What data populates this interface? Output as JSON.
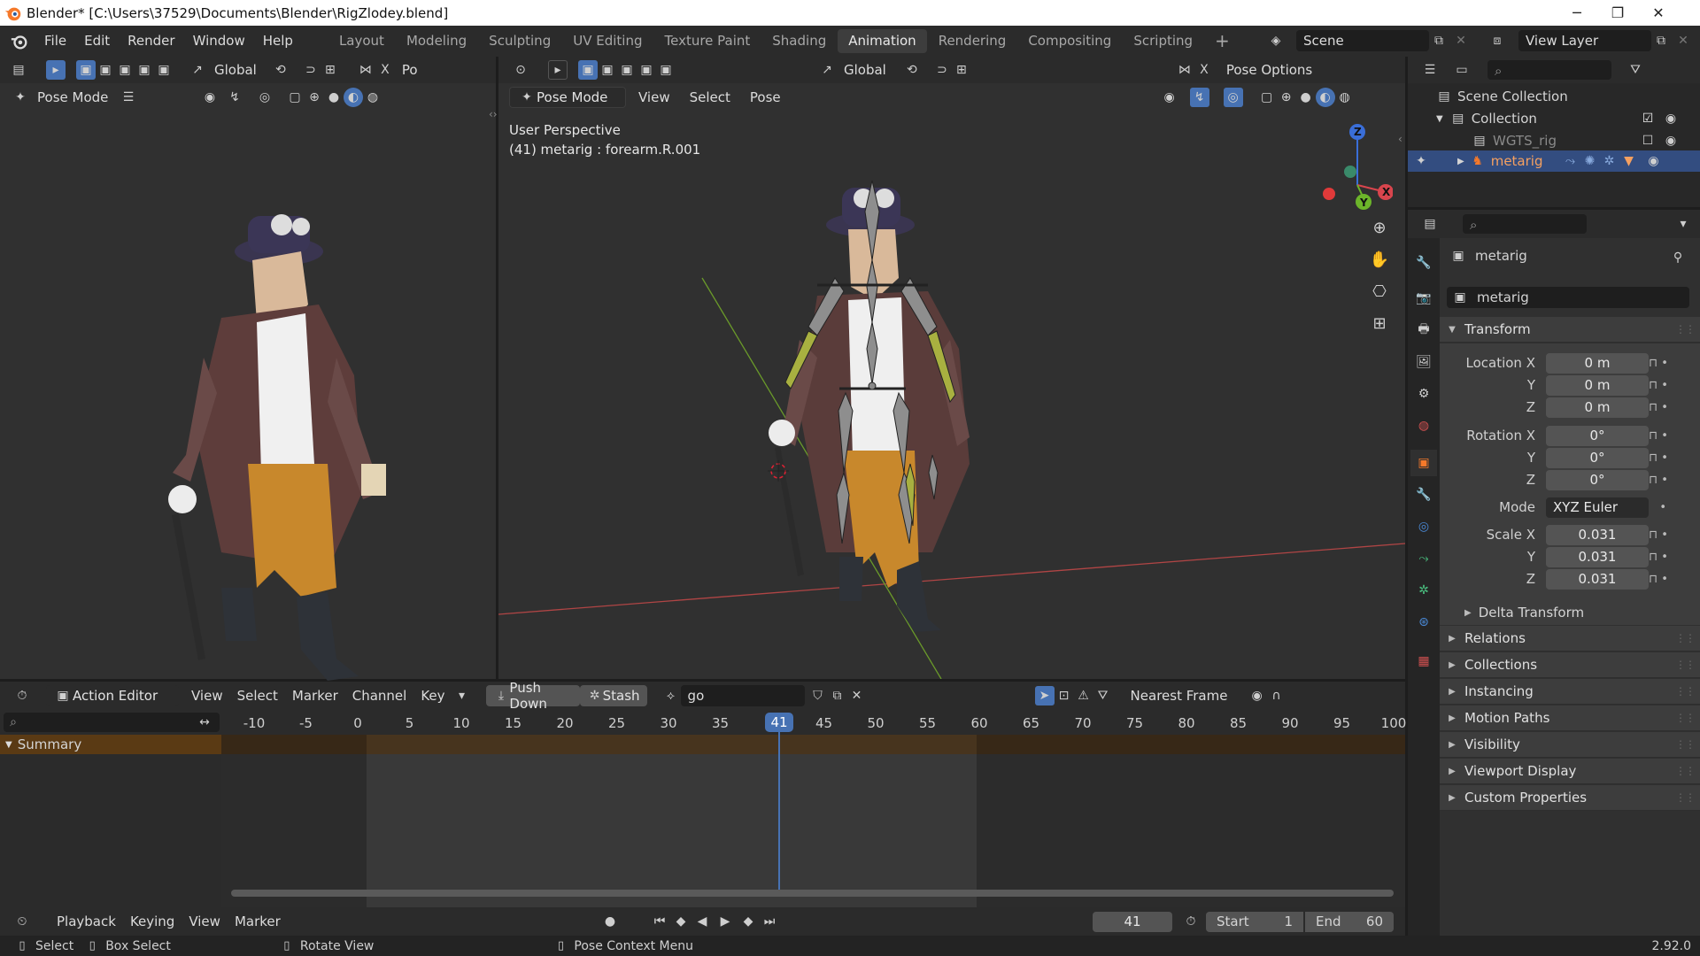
{
  "window": {
    "title": "Blender* [C:\\Users\\37529\\Documents\\Blender\\RigZlodey.blend]",
    "minimize": "─",
    "maximize": "❐",
    "close": "✕"
  },
  "menu": [
    "File",
    "Edit",
    "Render",
    "Window",
    "Help"
  ],
  "workspaces": [
    "Layout",
    "Modeling",
    "Sculpting",
    "UV Editing",
    "Texture Paint",
    "Shading",
    "Animation",
    "Rendering",
    "Compositing",
    "Scripting"
  ],
  "active_workspace": "Animation",
  "add_workspace": "+",
  "scene": {
    "name": "Scene"
  },
  "view_layer": {
    "name": "View Layer"
  },
  "left_viewport": {
    "orientation": "Global",
    "mode": "Pose Mode",
    "po_label": "Po"
  },
  "main_viewport": {
    "orientation": "Global",
    "mode": "Pose Mode",
    "menus": [
      "View",
      "Select",
      "Pose"
    ],
    "pose_options": "Pose Options",
    "perspective": "User Perspective",
    "active_bone": "(41) metarig : forearm.R.001",
    "gizmo": {
      "x": "X",
      "y": "Y",
      "z": "Z"
    }
  },
  "outliner": {
    "items": [
      {
        "label": "Scene Collection"
      },
      {
        "label": "Collection"
      },
      {
        "label": "WGTS_rig"
      },
      {
        "label": "metarig"
      }
    ]
  },
  "properties": {
    "object_name": "metarig",
    "datablock": "metarig",
    "transform_title": "Transform",
    "location": {
      "label": "Location X",
      "x": "0 m",
      "y": "0 m",
      "z": "0 m"
    },
    "rotation": {
      "label": "Rotation X",
      "x": "0°",
      "y": "0°",
      "z": "0°"
    },
    "axis_y": "Y",
    "axis_z": "Z",
    "mode_label": "Mode",
    "mode_value": "XYZ Euler",
    "scale": {
      "label": "Scale X",
      "x": "0.031",
      "y": "0.031",
      "z": "0.031"
    },
    "delta": "Delta Transform",
    "panels": [
      "Relations",
      "Collections",
      "Instancing",
      "Motion Paths",
      "Visibility",
      "Viewport Display",
      "Custom Properties"
    ]
  },
  "action_editor": {
    "mode": "Action Editor",
    "menus": [
      "View",
      "Select",
      "Marker",
      "Channel",
      "Key"
    ],
    "push_down": "Push Down",
    "stash": "Stash",
    "action_name": "go",
    "snap": "Nearest Frame",
    "summary": "Summary",
    "current_frame": "41",
    "ticks": [
      "-10",
      "-5",
      "0",
      "5",
      "10",
      "15",
      "20",
      "25",
      "30",
      "35",
      "45",
      "50",
      "55",
      "60",
      "65",
      "70",
      "75",
      "80",
      "85",
      "90",
      "95",
      "100"
    ]
  },
  "timeline": {
    "menus": [
      "Playback",
      "Keying",
      "View",
      "Marker"
    ],
    "frame": "41",
    "start_label": "Start",
    "start": "1",
    "end_label": "End",
    "end": "60"
  },
  "statusbar": {
    "select": "Select",
    "box_select": "Box Select",
    "rotate": "Rotate View",
    "context": "Pose Context Menu",
    "version": "2.92.0"
  },
  "colors": {
    "active_blue": "#4772b3",
    "orange": "#f5792a",
    "bg": "#303030",
    "header": "#2b2b2b",
    "summary": "#5a3a14"
  }
}
